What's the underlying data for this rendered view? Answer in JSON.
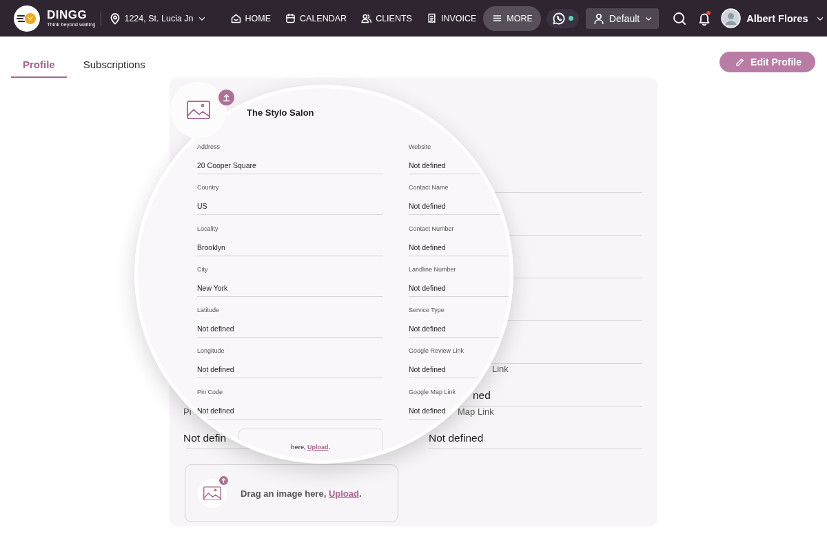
{
  "header": {
    "logo": {
      "name": "DINGG",
      "tagline": "Think beyond waiting"
    },
    "location": "1224, St. Lucia Jn",
    "nav": [
      {
        "label": "HOME",
        "selected": false
      },
      {
        "label": "CALENDAR",
        "selected": false
      },
      {
        "label": "CLIENTS",
        "selected": false
      },
      {
        "label": "INVOICE",
        "selected": false
      },
      {
        "label": "MORE",
        "selected": true
      }
    ],
    "whatsapp": {
      "online": true
    },
    "role": "Default",
    "notifications": {
      "unread": true
    },
    "user": "Albert Flores"
  },
  "tabs": [
    {
      "label": "Profile",
      "selected": true
    },
    {
      "label": "Subscriptions",
      "selected": false
    }
  ],
  "edit_button": "Edit Profile",
  "behind_magnifier": {
    "left": [
      {
        "label": "Pi",
        "value": "Not defin"
      }
    ],
    "right": [
      {
        "label": "Link",
        "value": "ned"
      },
      {
        "label": "Map Link",
        "value": "Not defined"
      }
    ]
  },
  "upload_box": {
    "text": "Drag an image here,",
    "link": "Upload",
    "end": "."
  },
  "magnifier": {
    "title": "The Stylo Salon",
    "left_fields": [
      {
        "label": "Address",
        "value": "20 Cooper Square"
      },
      {
        "label": "Country",
        "value": "US"
      },
      {
        "label": "Locality",
        "value": "Brooklyn"
      },
      {
        "label": "City",
        "value": "New York"
      },
      {
        "label": "Latitude",
        "value": "Not defined"
      },
      {
        "label": "Longitude",
        "value": "Not defined"
      },
      {
        "label": "Pin Code",
        "value": "Not defined"
      }
    ],
    "right_fields": [
      {
        "label": "Website",
        "value": "Not defined"
      },
      {
        "label": "Contact Name",
        "value": "Not defined"
      },
      {
        "label": "Contact Number",
        "value": "Not defined"
      },
      {
        "label": "Landline Number",
        "value": "Not defined"
      },
      {
        "label": "Service Type",
        "value": "Not defined"
      },
      {
        "label": "Google Review Link",
        "value": "Not defined"
      },
      {
        "label": "Google Map Link",
        "value": "Not defined"
      }
    ],
    "upload_hint": {
      "text": "here,",
      "link": "Upload",
      "end": "."
    }
  }
}
